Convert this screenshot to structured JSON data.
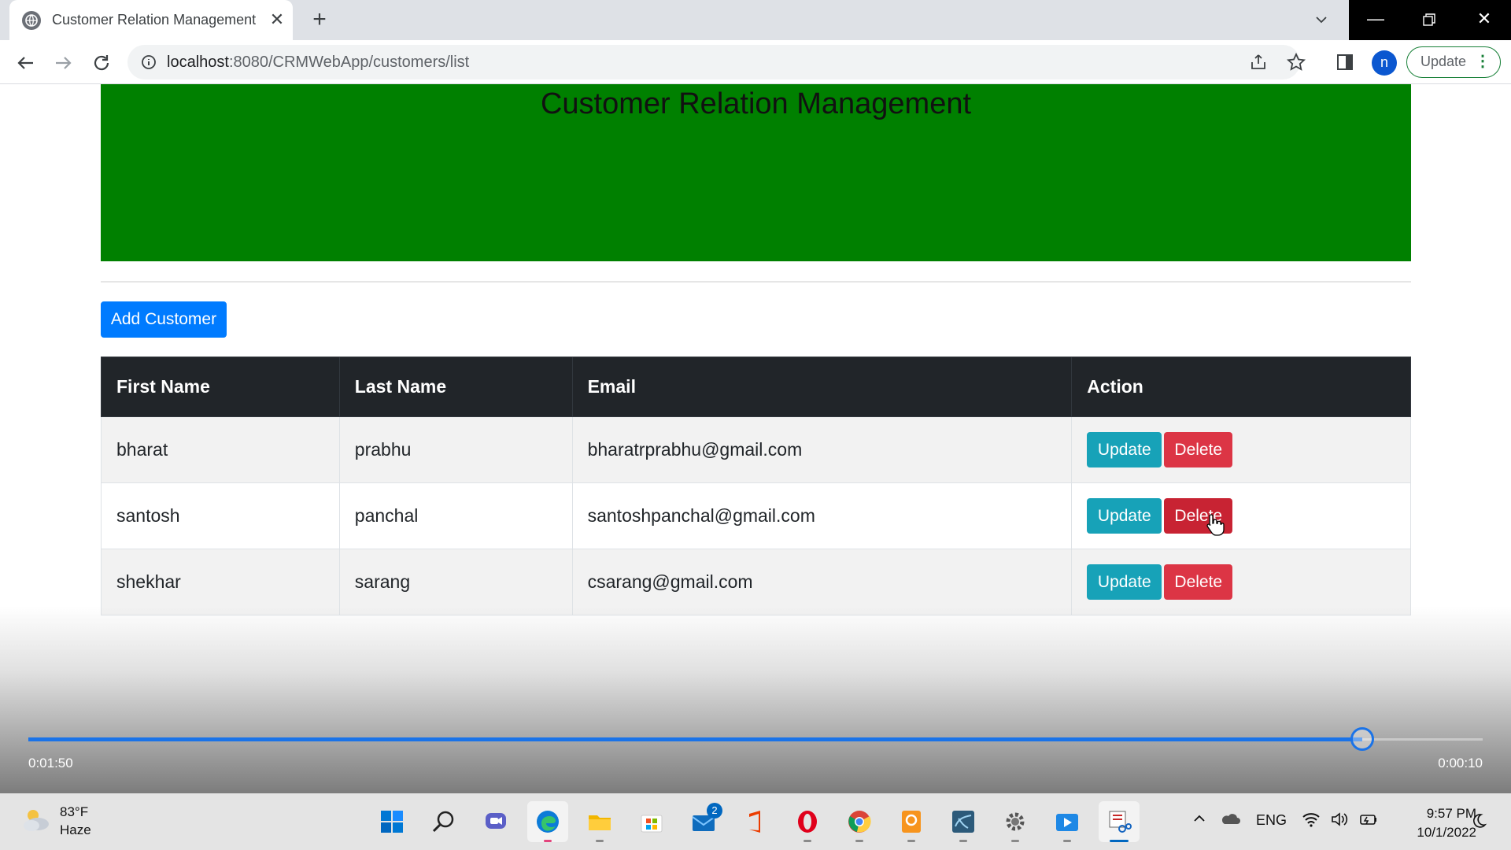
{
  "browser": {
    "tab_title": "Customer Relation Management",
    "url_host": "localhost",
    "url_path": ":8080/CRMWebApp/customers/list",
    "update_label": "Update",
    "profile_initial": "n"
  },
  "page": {
    "heading": "Customer Relation Management",
    "add_button": "Add Customer",
    "columns": [
      "First Name",
      "Last Name",
      "Email",
      "Action"
    ],
    "rows": [
      {
        "first": "bharat",
        "last": "prabhu",
        "email": "bharatrprabhu@gmail.com",
        "update": "Update",
        "delete": "Delete"
      },
      {
        "first": "santosh",
        "last": "panchal",
        "email": "santoshpanchal@gmail.com",
        "update": "Update",
        "delete": "Delete"
      },
      {
        "first": "shekhar",
        "last": "sarang",
        "email": "csarang@gmail.com",
        "update": "Update",
        "delete": "Delete"
      }
    ],
    "colors": {
      "header_bg": "#008000",
      "add_btn": "#007bff",
      "update_btn": "#17a2b8",
      "delete_btn": "#dc3545"
    }
  },
  "video": {
    "time_elapsed": "0:01:50",
    "time_remaining": "0:00:10",
    "progress": 0.917
  },
  "taskbar": {
    "temperature": "83°F",
    "condition": "Haze",
    "language": "ENG",
    "time": "9:57 PM",
    "date": "10/1/2022",
    "mail_badge": "2"
  }
}
